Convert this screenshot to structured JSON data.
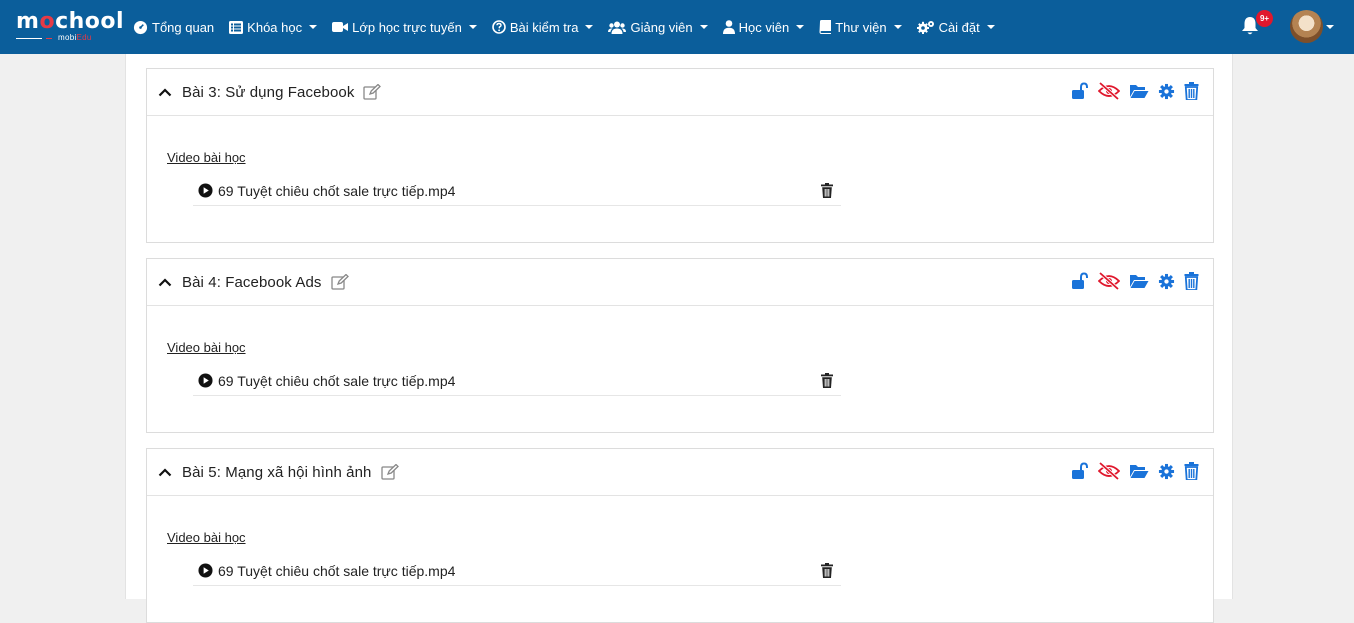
{
  "brand": {
    "logo_main_pre": "m",
    "logo_main_o": "o",
    "logo_main_post": "chool",
    "logo_sub_pre": "mobi",
    "logo_sub_accent": "Edu"
  },
  "nav": {
    "items": [
      {
        "label": "Tổng quan",
        "icon": "dashboard-icon",
        "dropdown": false
      },
      {
        "label": "Khóa học",
        "icon": "list-icon",
        "dropdown": true
      },
      {
        "label": "Lớp học trực tuyến",
        "icon": "video-camera-icon",
        "dropdown": true
      },
      {
        "label": "Bài kiểm tra",
        "icon": "question-circle-icon",
        "dropdown": true
      },
      {
        "label": "Giảng viên",
        "icon": "users-icon",
        "dropdown": true
      },
      {
        "label": "Học viên",
        "icon": "user-icon",
        "dropdown": true
      },
      {
        "label": "Thư viện",
        "icon": "book-icon",
        "dropdown": true
      },
      {
        "label": "Cài đặt",
        "icon": "cogs-icon",
        "dropdown": true
      }
    ],
    "notifications_badge": "9+"
  },
  "colors": {
    "navbar": "#0b5e9b",
    "accent_blue": "#1a73d9",
    "danger_red": "#e0182d"
  },
  "lessons": [
    {
      "title": "Bài 3: Sử dụng Facebook",
      "section_label": "Video bài học",
      "files": [
        "69 Tuyệt chiêu chốt sale trực tiếp.mp4"
      ]
    },
    {
      "title": "Bài 4: Facebook Ads",
      "section_label": "Video bài học",
      "files": [
        "69 Tuyệt chiêu chốt sale trực tiếp.mp4"
      ]
    },
    {
      "title": "Bài 5: Mạng xã hội hình ảnh",
      "section_label": "Video bài học",
      "files": [
        "69 Tuyệt chiêu chốt sale trực tiếp.mp4"
      ]
    }
  ]
}
